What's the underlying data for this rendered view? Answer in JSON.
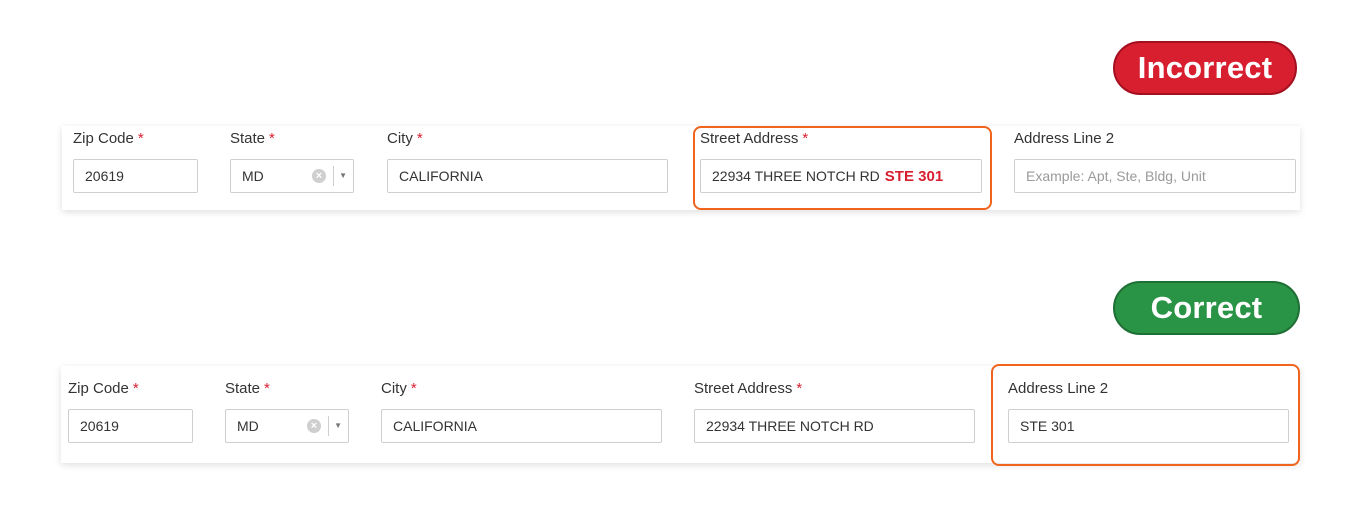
{
  "incorrect": {
    "badge": "Incorrect",
    "zip": {
      "label": "Zip Code",
      "required": "*",
      "value": "20619"
    },
    "state": {
      "label": "State",
      "required": "*",
      "value": "MD",
      "clear_icon": "x-circle-icon",
      "arrow_icon": "caret-down-icon"
    },
    "city": {
      "label": "City",
      "required": "*",
      "value": "CALIFORNIA"
    },
    "street": {
      "label": "Street Address",
      "required": "*",
      "value": "22934 THREE NOTCH RD",
      "value_highlight": "STE 301"
    },
    "line2": {
      "label": "Address Line 2",
      "placeholder": "Example: Apt, Ste, Bldg, Unit"
    }
  },
  "correct": {
    "badge": "Correct",
    "zip": {
      "label": "Zip Code",
      "required": "*",
      "value": "20619"
    },
    "state": {
      "label": "State",
      "required": "*",
      "value": "MD",
      "clear_icon": "x-circle-icon",
      "arrow_icon": "caret-down-icon"
    },
    "city": {
      "label": "City",
      "required": "*",
      "value": "CALIFORNIA"
    },
    "street": {
      "label": "Street Address",
      "required": "*",
      "value": "22934 THREE NOTCH RD"
    },
    "line2": {
      "label": "Address Line 2",
      "value": "STE 301"
    }
  },
  "colors": {
    "incorrect_badge": "#d71f30",
    "correct_badge": "#2a9446",
    "highlight_border": "#f0641e",
    "required_mark": "#d71f30"
  }
}
